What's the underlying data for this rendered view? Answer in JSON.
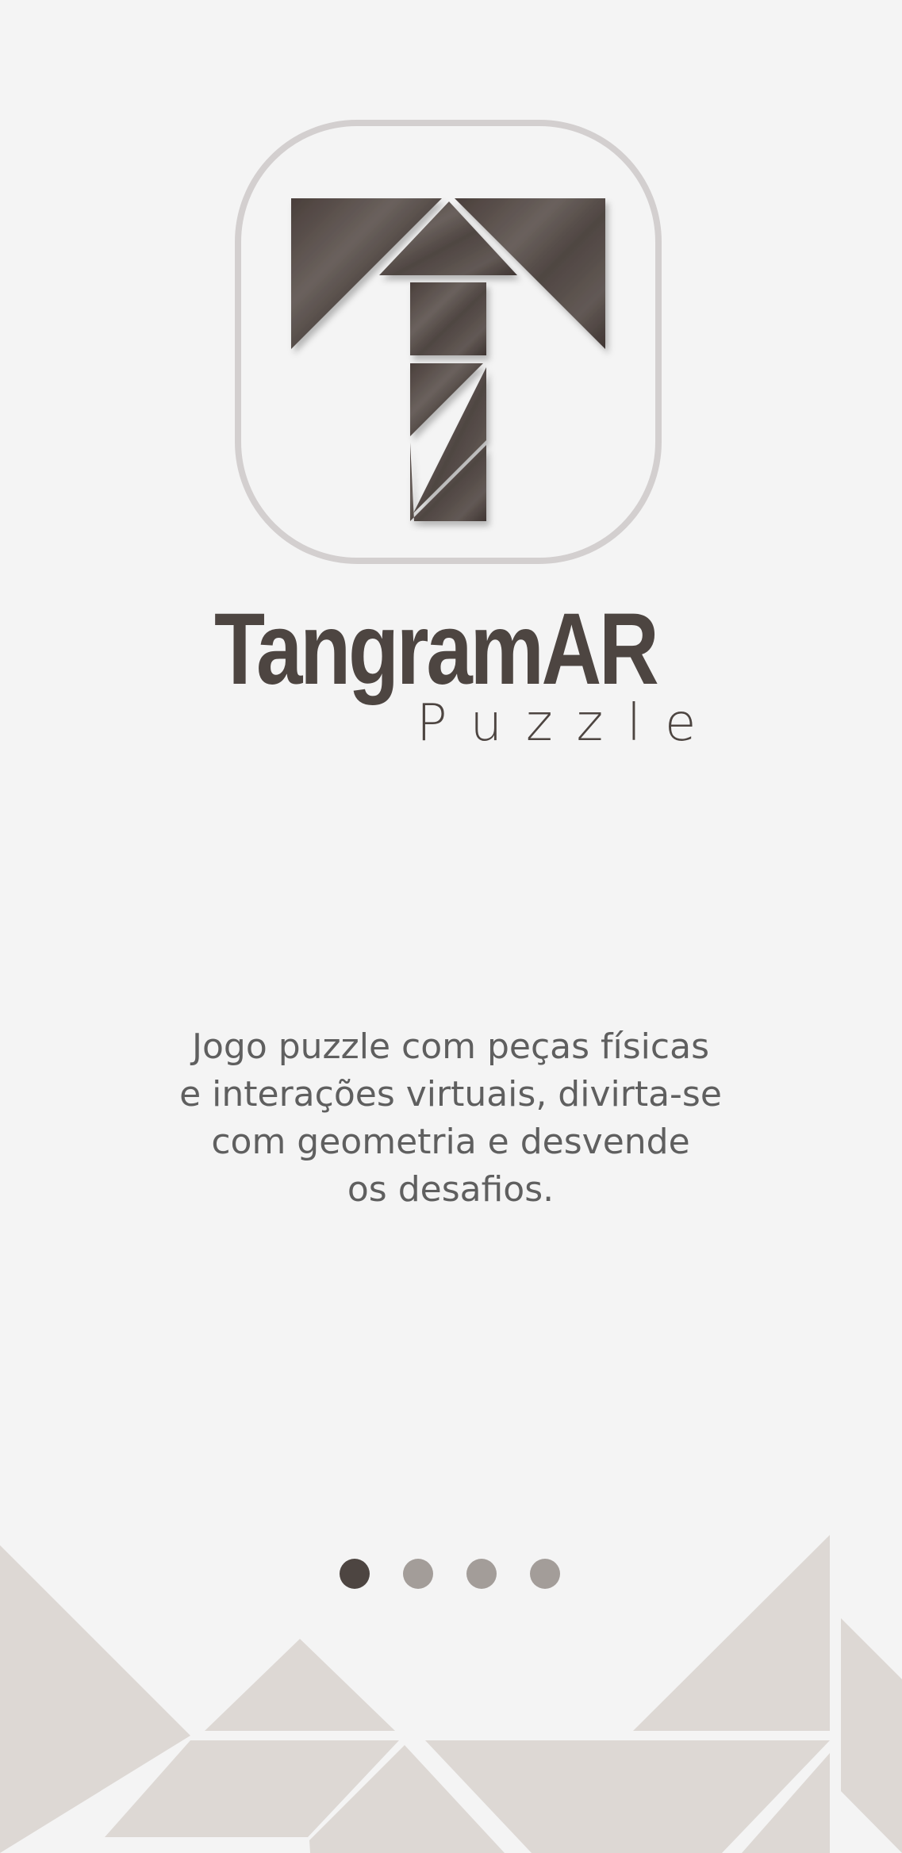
{
  "app": {
    "title": "TangramAR",
    "subtitle": "Puzzle"
  },
  "intro": {
    "description_lines": [
      "Jogo puzzle com peças físicas",
      "e interações virtuais, divirta-se",
      "com geometria e desvende",
      "os desafios."
    ]
  },
  "pager": {
    "total": 4,
    "active_index": 0
  },
  "colors": {
    "background": "#f4f4f4",
    "brand_dark": "#4d4541",
    "text_muted": "#5f5f5f",
    "dot_inactive": "#a39d99",
    "decor_piece": "#ddd8d4",
    "icon_border": "#d3cfcf"
  }
}
